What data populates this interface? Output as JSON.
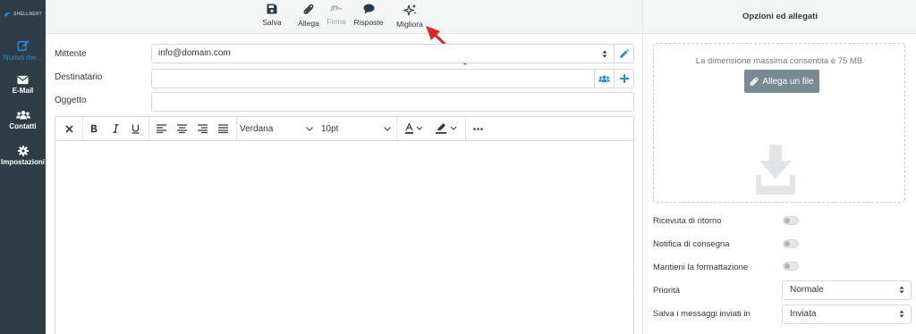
{
  "brand": {
    "logo_text": "SHELLRENT"
  },
  "rail": {
    "items": [
      {
        "label": "Nuovo me...",
        "icon": "compose-icon",
        "active": true
      },
      {
        "label": "E-Mail",
        "icon": "envelope-icon",
        "active": false
      },
      {
        "label": "Contatti",
        "icon": "users-icon",
        "active": false
      },
      {
        "label": "Impostazioni",
        "icon": "gear-icon",
        "active": false
      }
    ]
  },
  "toolbar": {
    "save": "Salva",
    "attach": "Allega",
    "signature": "Firma",
    "responses": "Risposte",
    "improve": "Migliora"
  },
  "form": {
    "sender_label": "Mittente",
    "sender_value": "info@domain.com",
    "recipient_label": "Destinatario",
    "recipient_value": "",
    "subject_label": "Oggetto",
    "subject_value": ""
  },
  "editor": {
    "font_family": "Verdana",
    "font_size": "10pt"
  },
  "options": {
    "title": "Opzioni ed allegati",
    "max_size_text": "La dimensione massima consentita è 75 MB",
    "attach_button": "Allega un file",
    "return_receipt": "Ricevuta di ritorno",
    "delivery_notice": "Notifica di consegna",
    "keep_formatting": "Mantieni la formattazione",
    "priority_label": "Priorità",
    "priority_value": "Normale",
    "save_sent_label": "Salva i messaggi inviati in",
    "save_sent_value": "Inviata"
  },
  "colors": {
    "rail_bg": "#2f3d46",
    "accent": "#2a8dd4",
    "arrow": "#e0262b"
  }
}
